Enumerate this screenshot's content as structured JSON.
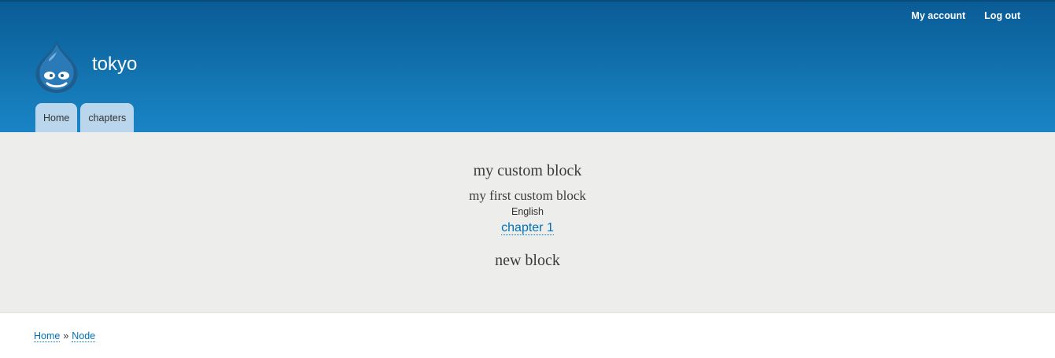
{
  "colors": {
    "header_top": "#0a5c96",
    "header_bottom": "#1a84c6",
    "tab_bg": "#b9d6ec",
    "featured_bg": "#edeeeb",
    "link": "#0071b3"
  },
  "secondary_menu": [
    {
      "label": "My account"
    },
    {
      "label": "Log out"
    }
  ],
  "site": {
    "logo_icon": "drupal-drop-icon",
    "name": "tokyo"
  },
  "main_menu": [
    {
      "label": "Home"
    },
    {
      "label": "chapters"
    }
  ],
  "featured": {
    "block1_title": "my custom block",
    "block1_body": "my first custom block",
    "language": "English",
    "chapter_link": "chapter 1",
    "block2_title": "new block"
  },
  "breadcrumb": {
    "items": [
      "Home",
      "Node"
    ],
    "separator": "»"
  }
}
